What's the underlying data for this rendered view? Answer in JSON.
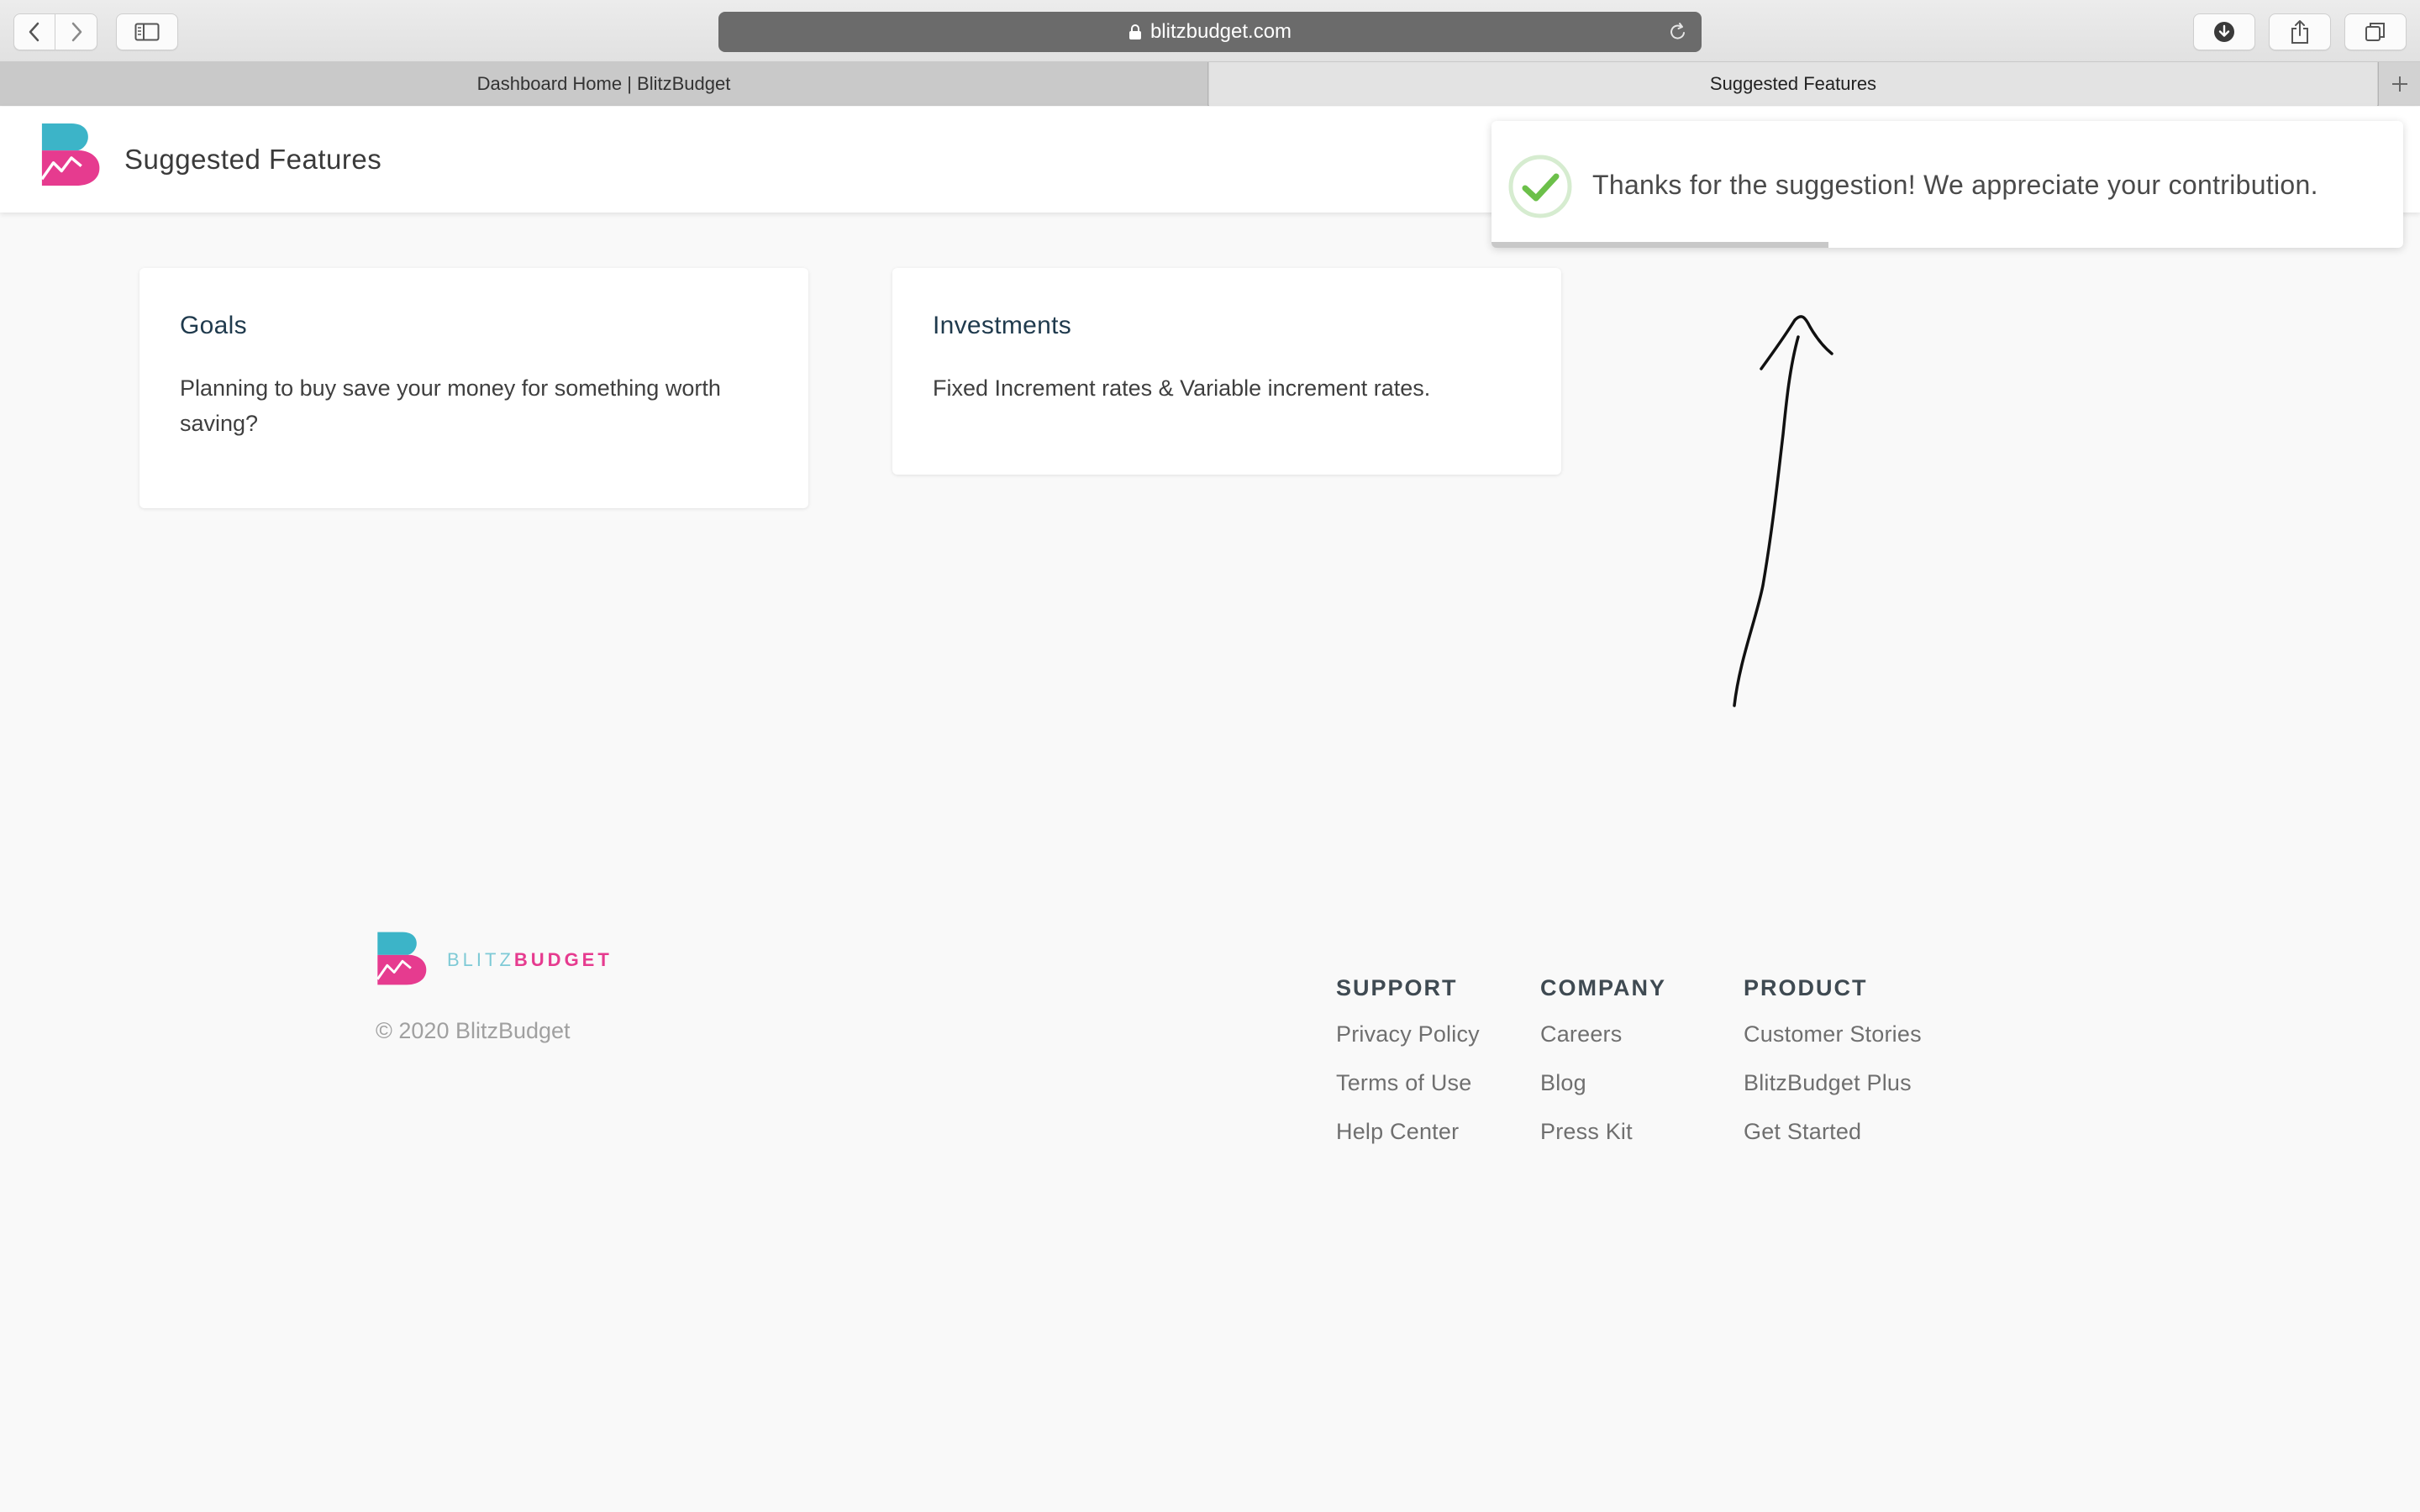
{
  "browser": {
    "url": "blitzbudget.com",
    "tabs": [
      {
        "title": "Dashboard Home | BlitzBudget",
        "active": false
      },
      {
        "title": "Suggested Features",
        "active": true
      }
    ]
  },
  "header": {
    "title": "Suggested Features"
  },
  "cards": [
    {
      "title": "Goals",
      "body": "Planning to buy save your money for something worth saving?"
    },
    {
      "title": "Investments",
      "body": "Fixed Increment rates & Variable increment rates."
    }
  ],
  "toast": {
    "message": "Thanks for the suggestion! We appreciate your contribution.",
    "progress_percent": 37,
    "icon": "check-circle-icon",
    "accent_color": "#6cc04a"
  },
  "footer": {
    "brand": {
      "part1": "BLITZ",
      "part2": "BUDGET"
    },
    "copyright": "© 2020 BlitzBudget",
    "columns": [
      {
        "heading": "SUPPORT",
        "links": [
          "Privacy Policy",
          "Terms of Use",
          "Help Center"
        ]
      },
      {
        "heading": "COMPANY",
        "links": [
          "Careers",
          "Blog",
          "Press Kit"
        ]
      },
      {
        "heading": "PRODUCT",
        "links": [
          "Customer Stories",
          "BlitzBudget Plus",
          "Get Started"
        ]
      }
    ]
  },
  "colors": {
    "brand_teal": "#3cb4c8",
    "brand_pink": "#e63b8f",
    "title_navy": "#1f3a4d"
  }
}
